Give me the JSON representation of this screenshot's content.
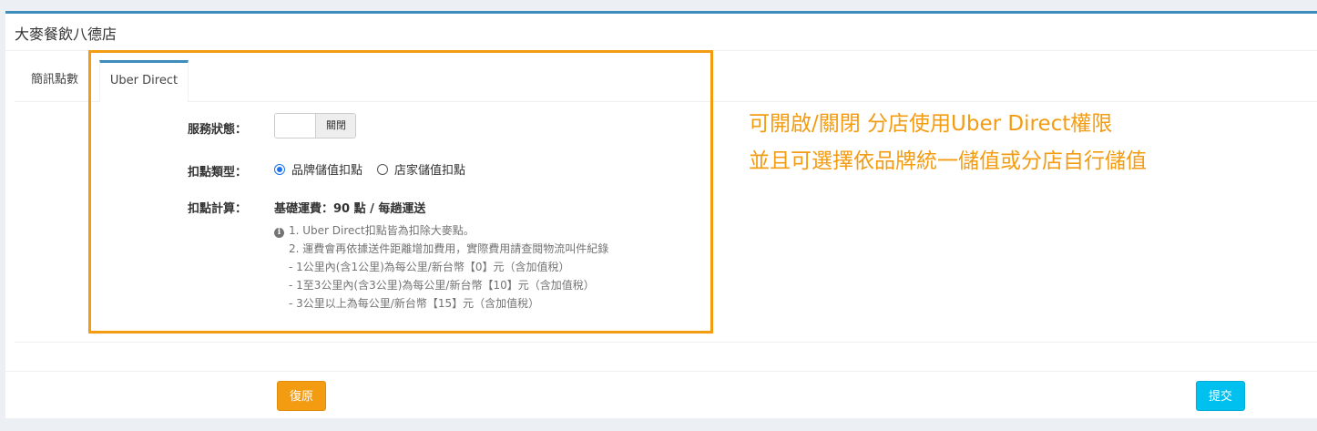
{
  "panel": {
    "title": "大麥餐飲八德店"
  },
  "tabs": [
    {
      "label": "簡訊點數",
      "active": false
    },
    {
      "label": "Uber Direct",
      "active": true
    }
  ],
  "form": {
    "service_status": {
      "label": "服務狀態：",
      "toggle_off_label": "關閉",
      "enabled": false
    },
    "deduct_type": {
      "label": "扣點類型：",
      "options": [
        {
          "label": "品牌儲值扣點",
          "checked": true
        },
        {
          "label": "店家儲值扣點",
          "checked": false
        }
      ]
    },
    "deduct_calc": {
      "label": "扣點計算：",
      "fee_text": "基礎運費：90 點 / 每趟運送",
      "notes": [
        "1. Uber Direct扣點皆為扣除大麥點。",
        "2. 運費會再依據送件距離增加費用，實際費用請查閱物流叫件紀錄",
        "- 1公里內(含1公里)為每公里/新台幣【0】元（含加值稅）",
        "- 1至3公里內(含3公里)為每公里/新台幣【10】元（含加值稅）",
        "- 3公里以上為每公里/新台幣【15】元（含加值稅）"
      ]
    }
  },
  "annotation": {
    "line1": "可開啟/關閉 分店使用Uber Direct權限",
    "line2": "並且可選擇依品牌統一儲值或分店自行儲值"
  },
  "buttons": {
    "reset": "復原",
    "submit": "提交"
  },
  "colors": {
    "accent_border": "#3c8dbc",
    "highlight": "#f39c12",
    "reset_button": "#f39c12",
    "submit_button": "#00c0ef",
    "radio_checked": "#1a73e8"
  },
  "icons": {
    "info": "info-circle-icon"
  }
}
